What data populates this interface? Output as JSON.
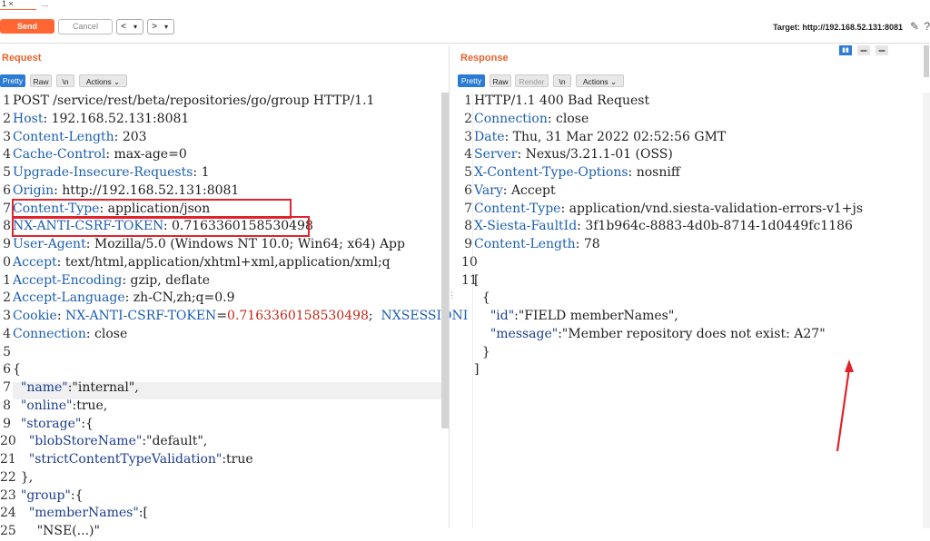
{
  "tabs": {
    "active_label": "1 ×",
    "more_label": "..."
  },
  "toolbar": {
    "send_label": "Send",
    "cancel_label": "Cancel",
    "back_label": "<",
    "back_dd": "▾",
    "fwd_label": ">",
    "fwd_dd": "▾",
    "target_label": "Target: http://192.168.52.131:8081"
  },
  "request": {
    "title": "Request",
    "buttons": {
      "pretty": "Pretty",
      "raw": "Raw",
      "newline": "\\n",
      "actions": "Actions ⌄"
    },
    "lines": [
      {
        "n": "1",
        "t": [
          [
            "",
            "POST /service/rest/beta/repositories/go/group HTTP/1.1"
          ]
        ]
      },
      {
        "n": "2",
        "t": [
          [
            "k",
            "Host"
          ],
          [
            "",
            ": 192.168.52.131:8081"
          ]
        ]
      },
      {
        "n": "3",
        "t": [
          [
            "k",
            "Content-Length"
          ],
          [
            "",
            ": 203"
          ]
        ]
      },
      {
        "n": "4",
        "t": [
          [
            "k",
            "Cache-Control"
          ],
          [
            "",
            ": max-age=0"
          ]
        ]
      },
      {
        "n": "5",
        "t": [
          [
            "k",
            "Upgrade-Insecure-Requests"
          ],
          [
            "",
            ": 1"
          ]
        ]
      },
      {
        "n": "6",
        "t": [
          [
            "k",
            "Origin"
          ],
          [
            "",
            ": http://192.168.52.131:8081"
          ]
        ]
      },
      {
        "n": "7",
        "t": [
          [
            "k",
            "Content-Type"
          ],
          [
            "",
            ": application/json"
          ]
        ]
      },
      {
        "n": "8",
        "t": [
          [
            "k",
            "NX-ANTI-CSRF-TOKEN"
          ],
          [
            "",
            ": 0.7163360158530498"
          ]
        ]
      },
      {
        "n": "9",
        "t": [
          [
            "k",
            "User-Agent"
          ],
          [
            "",
            ": Mozilla/5.0 (Windows NT 10.0; Win64; x64) App"
          ]
        ]
      },
      {
        "n": "0",
        "t": [
          [
            "k",
            "Accept"
          ],
          [
            "",
            ": text/html,application/xhtml+xml,application/xml;q"
          ]
        ]
      },
      {
        "n": "1",
        "t": [
          [
            "k",
            "Accept-Encoding"
          ],
          [
            "",
            ": gzip, deflate"
          ]
        ]
      },
      {
        "n": "2",
        "t": [
          [
            "k",
            "Accept-Language"
          ],
          [
            "",
            ": zh-CN,zh;q=0.9"
          ]
        ]
      },
      {
        "n": "3",
        "t": [
          [
            "k",
            "Cookie"
          ],
          [
            "",
            ": "
          ],
          [
            "k",
            "NX-ANTI-CSRF-TOKEN"
          ],
          [
            "",
            "="
          ],
          [
            "r",
            "0.7163360158530498"
          ],
          [
            "",
            ";  "
          ],
          [
            "k",
            "NXSESSIONI"
          ]
        ]
      },
      {
        "n": "4",
        "t": [
          [
            "k",
            "Connection"
          ],
          [
            "",
            ": close"
          ]
        ]
      },
      {
        "n": "5",
        "t": [
          [
            "",
            ""
          ]
        ]
      },
      {
        "n": "6",
        "t": [
          [
            "",
            "{"
          ]
        ]
      },
      {
        "n": "7",
        "t": [
          [
            "",
            "  "
          ],
          [
            "s",
            "\"name\""
          ],
          [
            "",
            ":\"internal\","
          ]
        ]
      },
      {
        "n": "8",
        "t": [
          [
            "",
            "  "
          ],
          [
            "s",
            "\"online\""
          ],
          [
            "",
            ":true,"
          ]
        ]
      },
      {
        "n": "9",
        "t": [
          [
            "",
            "  "
          ],
          [
            "s",
            "\"storage\""
          ],
          [
            "",
            ":{"
          ]
        ]
      },
      {
        "n": "20",
        "t": [
          [
            "",
            "    "
          ],
          [
            "s",
            "\"blobStoreName\""
          ],
          [
            "",
            ":\"default\","
          ]
        ]
      },
      {
        "n": "21",
        "t": [
          [
            "",
            "    "
          ],
          [
            "s",
            "\"strictContentTypeValidation\""
          ],
          [
            "",
            ":true"
          ]
        ]
      },
      {
        "n": "22",
        "t": [
          [
            "",
            "  },"
          ]
        ]
      },
      {
        "n": "23",
        "t": [
          [
            "",
            "  "
          ],
          [
            "s",
            "\"group\""
          ],
          [
            "",
            ":{"
          ]
        ]
      },
      {
        "n": "24",
        "t": [
          [
            "",
            "    "
          ],
          [
            "s",
            "\"memberNames\""
          ],
          [
            "",
            ":["
          ]
        ]
      },
      {
        "n": "25",
        "t": [
          [
            "",
            "      \"NSE(...)\""
          ]
        ]
      }
    ]
  },
  "response": {
    "title": "Response",
    "buttons": {
      "pretty": "Pretty",
      "raw": "Raw",
      "render": "Render",
      "newline": "\\n",
      "actions": "Actions ⌄"
    },
    "lines": [
      {
        "n": "1",
        "t": [
          [
            "",
            "HTTP/1.1 400 Bad Request"
          ]
        ]
      },
      {
        "n": "2",
        "t": [
          [
            "k",
            "Connection"
          ],
          [
            "",
            ": close"
          ]
        ]
      },
      {
        "n": "3",
        "t": [
          [
            "k",
            "Date"
          ],
          [
            "",
            ": Thu, 31 Mar 2022 02:52:56 GMT"
          ]
        ]
      },
      {
        "n": "4",
        "t": [
          [
            "k",
            "Server"
          ],
          [
            "",
            ": Nexus/3.21.1-01 (OSS)"
          ]
        ]
      },
      {
        "n": "5",
        "t": [
          [
            "k",
            "X-Content-Type-Options"
          ],
          [
            "",
            ": nosniff"
          ]
        ]
      },
      {
        "n": "6",
        "t": [
          [
            "k",
            "Vary"
          ],
          [
            "",
            ": Accept"
          ]
        ]
      },
      {
        "n": "7",
        "t": [
          [
            "k",
            "Content-Type"
          ],
          [
            "",
            ": application/vnd.siesta-validation-errors-v1+js"
          ]
        ]
      },
      {
        "n": "8",
        "t": [
          [
            "k",
            "X-Siesta-FaultId"
          ],
          [
            "",
            ": 3f1b964c-8883-4d0b-8714-1d0449fc1186"
          ]
        ]
      },
      {
        "n": "9",
        "t": [
          [
            "k",
            "Content-Length"
          ],
          [
            "",
            ": 78"
          ]
        ]
      },
      {
        "n": "10",
        "t": [
          [
            "",
            ""
          ]
        ]
      },
      {
        "n": "11",
        "t": [
          [
            "",
            "["
          ]
        ]
      },
      {
        "n": "",
        "t": [
          [
            "",
            "  {"
          ]
        ]
      },
      {
        "n": "",
        "t": [
          [
            "",
            "    "
          ],
          [
            "s",
            "\"id\""
          ],
          [
            "",
            ":\"FIELD memberNames\","
          ]
        ]
      },
      {
        "n": "",
        "t": [
          [
            "",
            "    "
          ],
          [
            "s",
            "\"message\""
          ],
          [
            "",
            ":\"Member repository does not exist: A27\""
          ]
        ]
      },
      {
        "n": "",
        "t": [
          [
            "",
            "  }"
          ]
        ]
      },
      {
        "n": "",
        "t": [
          [
            "",
            "]"
          ]
        ]
      }
    ]
  },
  "colors": {
    "accent": "#ff6633",
    "key": "#1d5fb0",
    "highlight_box": "#e0242c"
  }
}
